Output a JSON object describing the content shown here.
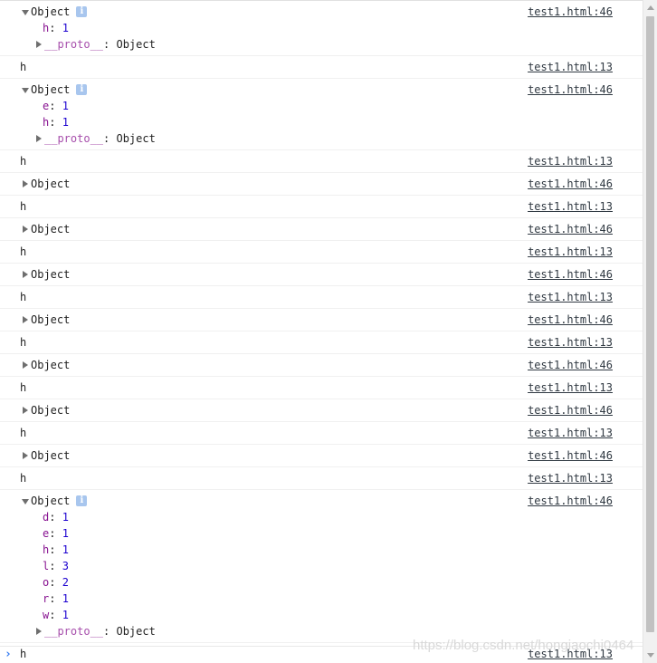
{
  "messages": [
    {
      "kind": "object",
      "label": "Object",
      "expanded": true,
      "info": true,
      "source": "test1.html:46",
      "props": [
        {
          "key": "h",
          "value": "1"
        }
      ],
      "proto_key": "__proto__",
      "proto_value": "Object"
    },
    {
      "kind": "text",
      "text": "h",
      "source": "test1.html:13"
    },
    {
      "kind": "object",
      "label": "Object",
      "expanded": true,
      "info": true,
      "source": "test1.html:46",
      "props": [
        {
          "key": "e",
          "value": "1"
        },
        {
          "key": "h",
          "value": "1"
        }
      ],
      "proto_key": "__proto__",
      "proto_value": "Object"
    },
    {
      "kind": "text",
      "text": "h",
      "source": "test1.html:13"
    },
    {
      "kind": "object",
      "label": "Object",
      "expanded": false,
      "source": "test1.html:46"
    },
    {
      "kind": "text",
      "text": "h",
      "source": "test1.html:13"
    },
    {
      "kind": "object",
      "label": "Object",
      "expanded": false,
      "source": "test1.html:46"
    },
    {
      "kind": "text",
      "text": "h",
      "source": "test1.html:13"
    },
    {
      "kind": "object",
      "label": "Object",
      "expanded": false,
      "source": "test1.html:46"
    },
    {
      "kind": "text",
      "text": "h",
      "source": "test1.html:13"
    },
    {
      "kind": "object",
      "label": "Object",
      "expanded": false,
      "source": "test1.html:46"
    },
    {
      "kind": "text",
      "text": "h",
      "source": "test1.html:13"
    },
    {
      "kind": "object",
      "label": "Object",
      "expanded": false,
      "source": "test1.html:46"
    },
    {
      "kind": "text",
      "text": "h",
      "source": "test1.html:13"
    },
    {
      "kind": "object",
      "label": "Object",
      "expanded": false,
      "source": "test1.html:46"
    },
    {
      "kind": "text",
      "text": "h",
      "source": "test1.html:13"
    },
    {
      "kind": "object",
      "label": "Object",
      "expanded": false,
      "source": "test1.html:46"
    },
    {
      "kind": "text",
      "text": "h",
      "source": "test1.html:13"
    },
    {
      "kind": "object",
      "label": "Object",
      "expanded": true,
      "info": true,
      "source": "test1.html:46",
      "props": [
        {
          "key": "d",
          "value": "1"
        },
        {
          "key": "e",
          "value": "1"
        },
        {
          "key": "h",
          "value": "1"
        },
        {
          "key": "l",
          "value": "3"
        },
        {
          "key": "o",
          "value": "2"
        },
        {
          "key": "r",
          "value": "1"
        },
        {
          "key": "w",
          "value": "1"
        }
      ],
      "proto_key": "__proto__",
      "proto_value": "Object"
    },
    {
      "kind": "text",
      "text": "h",
      "source": "test1.html:13"
    }
  ],
  "info_glyph": "i",
  "prompt_glyph": "›",
  "watermark": "https://blog.csdn.net/hongiaochi0464",
  "colors": {
    "key": "#881391",
    "number": "#1c00cf",
    "proto": "#a74fac",
    "prompt": "#367cf1"
  }
}
